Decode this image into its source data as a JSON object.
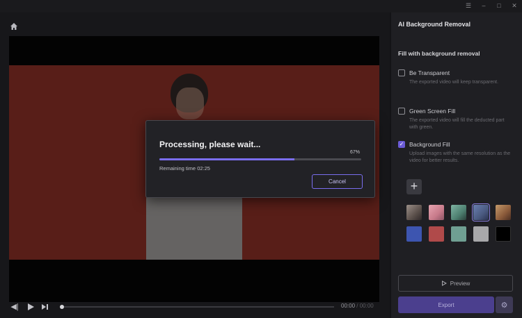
{
  "window": {
    "controls": [
      {
        "name": "menu",
        "glyph": "☰"
      },
      {
        "name": "minimize",
        "glyph": "–"
      },
      {
        "name": "maximize",
        "glyph": "□"
      },
      {
        "name": "close",
        "glyph": "✕"
      }
    ]
  },
  "player": {
    "time_current": "00:00",
    "time_separator": "/",
    "time_total": "00:00",
    "playhead_fraction": 0.0
  },
  "panel": {
    "title": "AI Background Removal",
    "section_title": "Fill with background removal",
    "options": [
      {
        "label": "Be Transparent",
        "description": "The exported video will keep transparent.",
        "checked": false
      },
      {
        "label": "Green Screen Fill",
        "description": "The exported video will fill the deducted part with green.",
        "checked": false
      },
      {
        "label": "Background Fill",
        "description": "Upload images with the same resolution as the video for better results.",
        "checked": true
      }
    ],
    "add_label": "+",
    "image_swatches": [
      "image-1",
      "image-2",
      "image-3",
      "image-4",
      "image-5"
    ],
    "selected_image_swatch": "image-4",
    "color_swatches": [
      "#3d55b0",
      "#b04a4a",
      "#6f9f92",
      "#a8a8aa",
      "#000000"
    ],
    "preview_label": "Preview",
    "export_label": "Export"
  },
  "modal": {
    "title": "Processing, please wait...",
    "percent_text": "67%",
    "progress_fraction": 0.67,
    "remaining_label": "Remaining time",
    "remaining_value": "02:25",
    "cancel_label": "Cancel"
  },
  "colors": {
    "accent": "#7b6ef0",
    "video_background": "#7a2a22"
  }
}
